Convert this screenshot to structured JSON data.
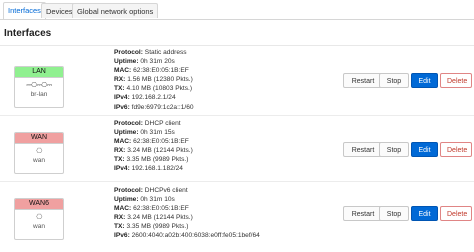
{
  "tabs": [
    "Interfaces",
    "Devices",
    "Global network options"
  ],
  "section_title": "Interfaces",
  "buttons": {
    "restart": "Restart",
    "stop": "Stop",
    "edit": "Edit",
    "delete": "Delete"
  },
  "labels": {
    "protocol": "Protocol:",
    "uptime": "Uptime:",
    "mac": "MAC:",
    "rx": "RX:",
    "tx": "TX:",
    "ipv4": "IPv4:",
    "ipv6": "IPv6:"
  },
  "interfaces": [
    {
      "name": "LAN",
      "color": "#90f090",
      "device": "br-lan",
      "icon": "bridge-icon",
      "icon_glyph": "⎓⎔⎓⎔⎓",
      "protocol": "Static address",
      "uptime": "0h 31m 20s",
      "mac": "62:38:E0:05:1B:EF",
      "rx": "1.56 MB (12380 Pkts.)",
      "tx": "4.10 MB (10803 Pkts.)",
      "ipv4": "192.168.2.1/24",
      "ipv6": "fd9e:6979:1c2a::1/60"
    },
    {
      "name": "WAN",
      "color": "#f0a0a0",
      "device": "wan",
      "icon": "ethernet-port-icon",
      "icon_glyph": "⎔",
      "protocol": "DHCP client",
      "uptime": "0h 31m 15s",
      "mac": "62:38:E0:05:1B:EF",
      "rx": "3.24 MB (12144 Pkts.)",
      "tx": "3.35 MB (9989 Pkts.)",
      "ipv4": "192.168.1.182/24"
    },
    {
      "name": "WAN6",
      "color": "#f0a0a0",
      "device": "wan",
      "icon": "ethernet-port-icon",
      "icon_glyph": "⎔",
      "protocol": "DHCPv6 client",
      "uptime": "0h 31m 10s",
      "mac": "62:38:E0:05:1B:EF",
      "rx": "3.24 MB (12144 Pkts.)",
      "tx": "3.35 MB (9989 Pkts.)",
      "ipv6": "2600:4040:a02b:400:6038:e0ff:fe05:1bef/64"
    }
  ]
}
